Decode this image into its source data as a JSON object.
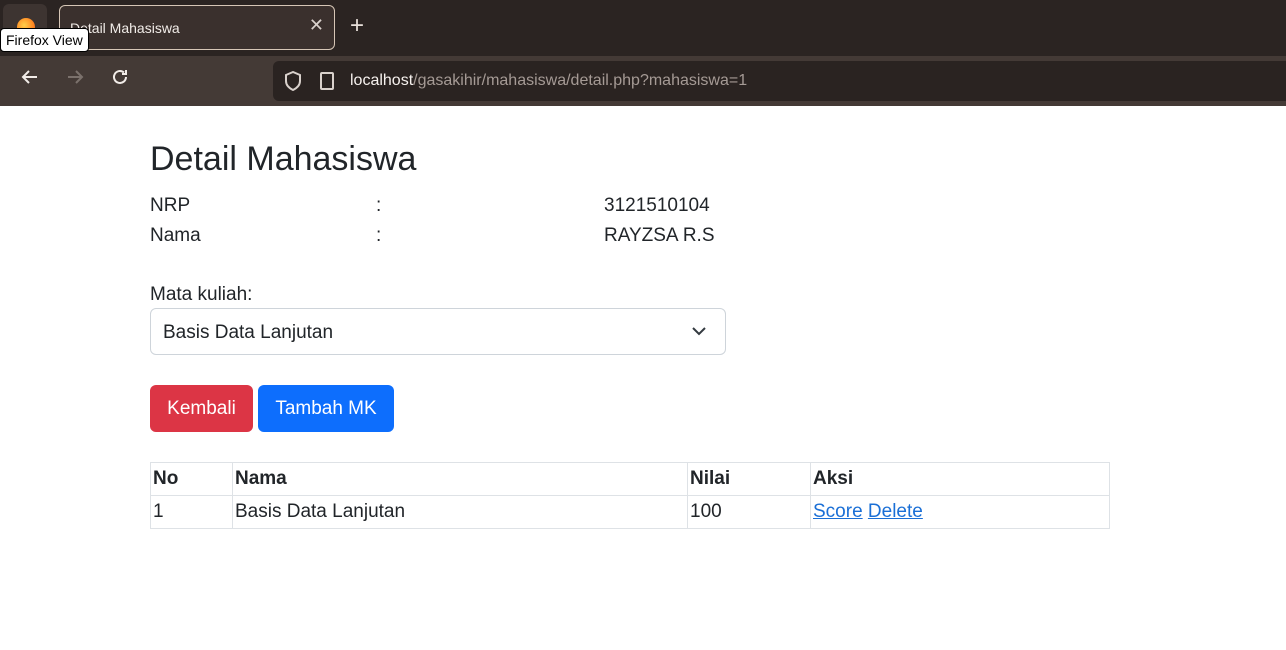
{
  "browser": {
    "tab_title": "Detail Mahasiswa",
    "tooltip": "Firefox View",
    "url_host": "localhost",
    "url_path": "/gasakihir/mahasiswa/detail.php?mahasiswa=1"
  },
  "page": {
    "title": "Detail Mahasiswa",
    "info": [
      {
        "label": "NRP",
        "colon": ":",
        "value": "3121510104"
      },
      {
        "label": "Nama",
        "colon": ":",
        "value": "RAYZSA R.S"
      }
    ],
    "mk_label": "Mata kuliah:",
    "mk_selected": "Basis Data Lanjutan",
    "buttons": {
      "back": "Kembali",
      "add": "Tambah MK"
    },
    "table": {
      "headers": [
        "No",
        "Nama",
        "Nilai",
        "Aksi"
      ],
      "rows": [
        {
          "no": "1",
          "nama": "Basis Data Lanjutan",
          "nilai": "100",
          "score_link": "Score",
          "delete_link": "Delete"
        }
      ]
    }
  },
  "colors": {
    "danger": "#dc3545",
    "primary": "#0d6efd",
    "link": "#1a6fd6"
  }
}
